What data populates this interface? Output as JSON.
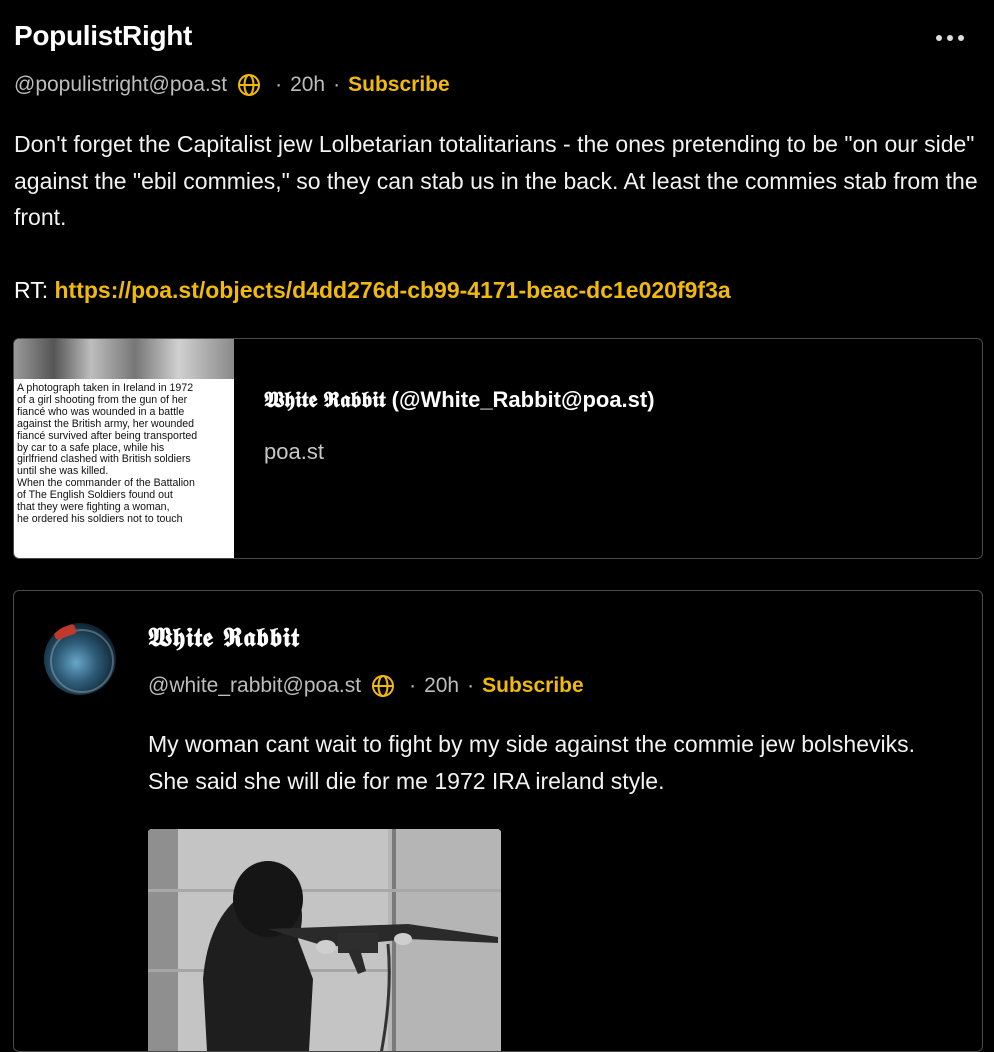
{
  "post": {
    "author_name": "PopulistRight",
    "handle": "@populistright@poa.st",
    "time": "20h",
    "separator": "·",
    "subscribe_label": "Subscribe",
    "more_icon": "more-horizontal-icon",
    "globe_icon": "globe-icon",
    "body": "Don't forget the Capitalist jew Lolbetarian totalitarians - the ones pretending to be \"on our side\" against the \"ebil commies,\" so they can stab us in the back. At least the commies stab from the front.",
    "rt_label": "RT:",
    "rt_link": "https://poa.st/objects/d4dd276d-cb99-4171-beac-dc1e020f9f3a"
  },
  "link_card": {
    "thumbnail_text": "A photograph taken in Ireland in 1972\nof a girl shooting from the gun of her\nfiancé who was wounded in a battle\nagainst the British army, her wounded\nfiancé survived after being transported\nby car to a safe place, while his\ngirlfriend clashed with British soldiers\nuntil she was killed.\nWhen the commander of the Battalion\nof The English Soldiers found out\nthat they were fighting a woman,\nhe ordered his soldiers not to touch",
    "title": "𝖂𝖍𝖎𝖙𝖊 𝕽𝖆𝖇𝖇𝖎𝖙 (@White_Rabbit@poa.st)",
    "domain": "poa.st"
  },
  "quoted": {
    "author_name": "𝖂𝖍𝖎𝖙𝖊 𝕽𝖆𝖇𝖇𝖎𝖙",
    "handle": "@white_rabbit@poa.st",
    "time": "20h",
    "separator": "·",
    "subscribe_label": "Subscribe",
    "body": "My woman cant wait to fight by my side against the commie jew bolsheviks. She said she will die for me 1972 IRA ireland style.",
    "image_alt": "black and white photo of a woman aiming a rifle"
  },
  "colors": {
    "background": "#000000",
    "accent": "#f0b90b",
    "muted_text": "#bdbdbd",
    "border": "#4a4a4a"
  }
}
